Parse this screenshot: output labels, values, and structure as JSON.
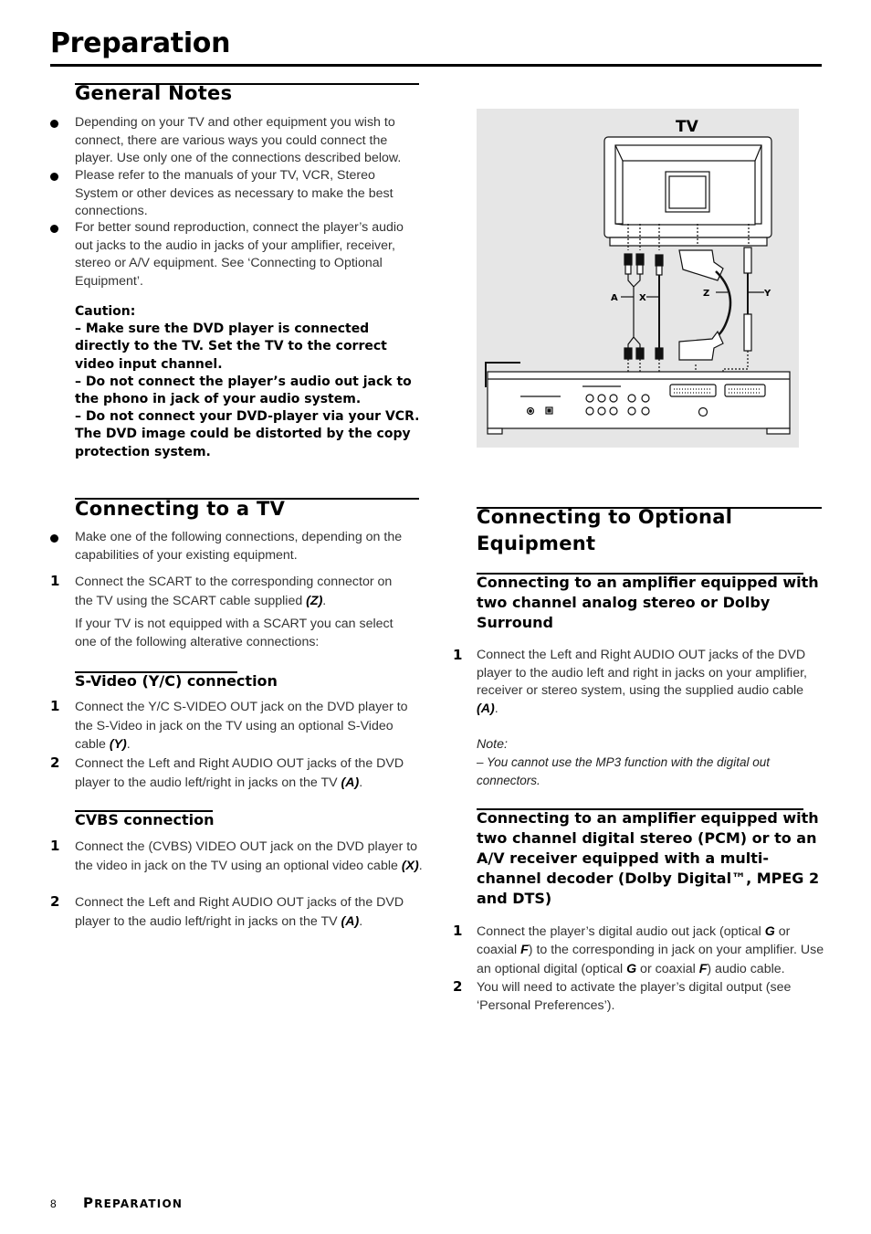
{
  "page": {
    "title": "Preparation",
    "footer": {
      "page_number": "8",
      "section_first": "P",
      "section_rest": "REPARATION"
    }
  },
  "general_notes": {
    "heading": "General Notes",
    "bullets": [
      "Depending on your TV and other equipment you wish to connect, there are various ways you could connect the player. Use only one of the connections described below.",
      "Please refer to the manuals of your TV, VCR, Stereo System or other devices as necessary to make the best connections.",
      "For better sound reproduction, connect the player’s audio out jacks to the audio in jacks of your amplifier, receiver, stereo or A/V equipment.  See ‘Connecting to Optional Equipment’."
    ],
    "caution": {
      "label": "Caution:",
      "lines": [
        "– Make sure the DVD player is connected directly to the TV. Set the TV to the correct video input channel.",
        "–  Do not connect  the player’s audio out jack to the phono in jack of your audio system.",
        "–  Do not connect your DVD-player via your VCR. The DVD image could be distorted by the copy protection system."
      ]
    }
  },
  "connecting_tv": {
    "heading": "Connecting to a TV",
    "bullet": "Make one of the following connections, depending on the capabilities of your existing equipment.",
    "step1": {
      "num": "1",
      "text": "Connect the SCART to the corresponding connector on the TV using the SCART cable supplied ",
      "ref": "(Z)",
      "end": "."
    },
    "alt_text": "If your TV is not equipped with a SCART you can select one of the following alterative connections:",
    "svideo": {
      "heading": "S-Video (Y/C) connection",
      "steps": [
        {
          "num": "1",
          "text": "Connect the Y/C S-VIDEO OUT jack on the DVD player to the S-Video in jack on the TV using an optional S-Video cable ",
          "ref": "(Y)",
          "end": "."
        },
        {
          "num": "2",
          "text": "Connect the Left and Right AUDIO OUT jacks of the DVD player to the audio left/right in jacks on the TV ",
          "ref": "(A)",
          "end": "."
        }
      ]
    },
    "cvbs": {
      "heading": "CVBS connection",
      "steps": [
        {
          "num": "1",
          "text": "Connect the (CVBS) VIDEO OUT jack on the DVD player to the video in jack on the TV using an optional video cable ",
          "ref": "(X)",
          "end": "."
        },
        {
          "num": "2",
          "text": "Connect the Left and Right AUDIO OUT jacks of the DVD player to the audio left/right in jacks on the TV ",
          "ref": "(A)",
          "end": "."
        }
      ]
    }
  },
  "diagram": {
    "tv_label": "TV",
    "cable_labels": {
      "a": "A",
      "x": "X",
      "z": "Z",
      "y": "Y"
    },
    "colors": {
      "background": "#e6e6e6",
      "line": "#111111",
      "fill": "#ffffff"
    }
  },
  "optional_equipment": {
    "heading_line1": "Connecting to Optional",
    "heading_line2": "Equipment",
    "analog": {
      "heading": "Connecting to an amplifier equipped with two channel analog  stereo or Dolby Surround",
      "step1": {
        "num": "1",
        "text": "Connect the Left and Right AUDIO OUT jacks of the DVD player to the audio left and right in jacks on your amplifier, receiver or stereo system, using the supplied audio cable ",
        "ref": "(A)",
        "end": "."
      },
      "note_label": "Note:",
      "note_text": "–  You cannot use the MP3 function with the digital out connectors."
    },
    "digital": {
      "heading": "Connecting to an amplifier equipped with two channel digital stereo (PCM) or to an A/V receiver equipped with a multi-channel decoder (Dolby Digital™, MPEG 2 and DTS)",
      "step1": {
        "num": "1",
        "p1": "Connect the player’s digital audio out jack (optical ",
        "g1": "G",
        "p2": " or coaxial ",
        "f1": "F",
        "p3": ") to the corresponding in jack on your amplifier. Use an optional digital (optical ",
        "g2": "G",
        "p4": " or coaxial ",
        "f2": "F",
        "p5": ") audio cable."
      },
      "step2": {
        "num": "2",
        "text": "You will need to activate the player’s digital output (see ‘Personal Preferences’)."
      }
    }
  }
}
